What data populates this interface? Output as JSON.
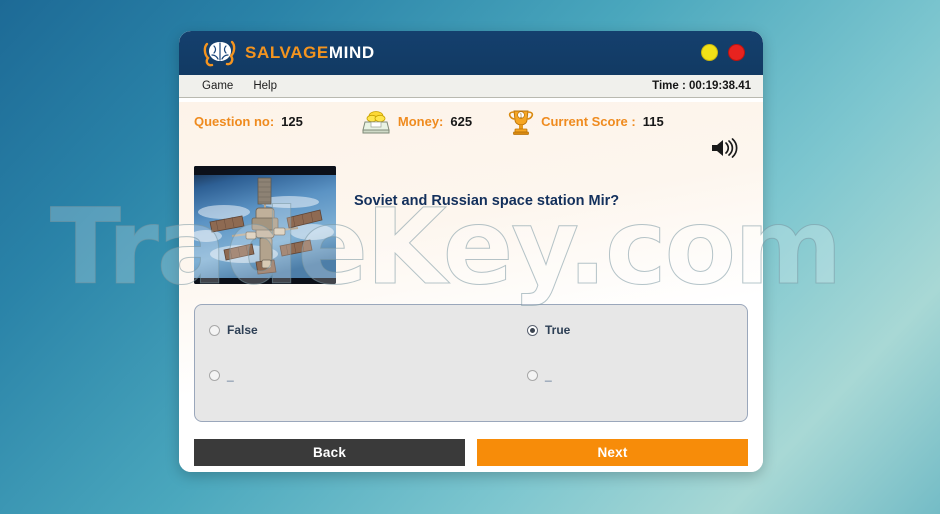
{
  "desktop": {
    "watermark_text": "TradeKey.com",
    "bg_color_top_left": "#1d6a96",
    "bg_color_bottom_right": "#74bcc6"
  },
  "window": {
    "titlebar": {
      "brand_primary": "SALVAGE",
      "brand_secondary": "MIND",
      "brand_primary_color": "#f4941f",
      "brand_secondary_color": "#ffffff",
      "logo_icon": "brain-icon",
      "bg_color": "#14406e",
      "controls": [
        {
          "name": "minimize",
          "icon": "minimize-dot-icon",
          "color": "#f2e117"
        },
        {
          "name": "close",
          "icon": "close-dot-icon",
          "color": "#e8231f"
        }
      ]
    },
    "menubar": {
      "items": [
        {
          "label": "Game"
        },
        {
          "label": "Help"
        }
      ],
      "clock": "Time : 00:19:38.41"
    },
    "stats": {
      "question_label": "Question no:",
      "question_value": "125",
      "money_icon": "money-stack-icon",
      "money_label": "Money:",
      "money_value": "625",
      "score_icon": "trophy-icon",
      "score_label": "Current Score :",
      "score_value": "115",
      "label_color": "#ef8b1f",
      "value_color": "#181818"
    },
    "sound": {
      "icon": "speaker-volume-icon"
    },
    "question": {
      "image_alt": "space-station-mir-photo",
      "text": "Soviet and Russian space station Mir?"
    },
    "answers": {
      "options": [
        {
          "label": "False",
          "selected": false,
          "blank": false
        },
        {
          "label": "True",
          "selected": true,
          "blank": false
        },
        {
          "label": "_",
          "selected": false,
          "blank": true
        },
        {
          "label": "_",
          "selected": false,
          "blank": true
        }
      ]
    },
    "actions": {
      "back_label": "Back",
      "back_color": "#3a3a3a",
      "next_label": "Next",
      "next_color": "#f78c09"
    }
  }
}
